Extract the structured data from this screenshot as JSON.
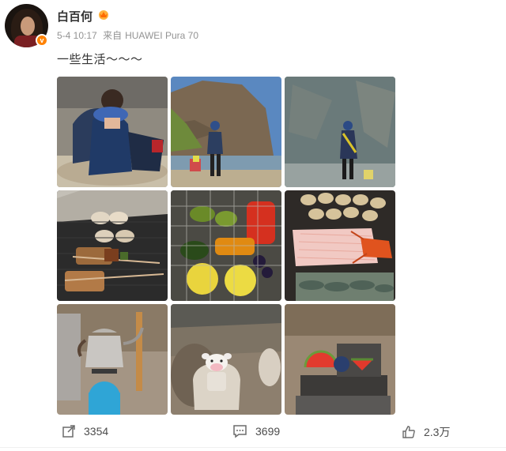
{
  "user": {
    "name": "白百何",
    "verified_badge": "v",
    "icons": {
      "avatar": "avatar",
      "verified": "verified-badge-icon",
      "member": "member-crown-icon"
    }
  },
  "meta": {
    "date": "5-4 10:17",
    "source_prefix": "来自",
    "device": "HUAWEI Pura 70"
  },
  "post": {
    "text": "一些生活～～～"
  },
  "photos": [
    {
      "name": "photo-1",
      "description": "child with cap crouching on rocky riverbank"
    },
    {
      "name": "photo-2",
      "description": "person walking by river under cliff"
    },
    {
      "name": "photo-3",
      "description": "person standing near cliff wall"
    },
    {
      "name": "photo-4",
      "description": "grilled skewers and oysters on grill"
    },
    {
      "name": "photo-5",
      "description": "vegetables and fruit in grill basket"
    },
    {
      "name": "photo-6",
      "description": "scallops, fish and lobster on ice"
    },
    {
      "name": "photo-7",
      "description": "kettle on camping stove"
    },
    {
      "name": "photo-8",
      "description": "small cow figure on rock"
    },
    {
      "name": "photo-9",
      "description": "watermelon slices on table"
    }
  ],
  "actions": {
    "share": {
      "count": "3354",
      "icon": "share-icon"
    },
    "comment": {
      "count": "3699",
      "icon": "comment-icon"
    },
    "like": {
      "count": "2.3万",
      "icon": "thumbs-up-icon"
    }
  },
  "colors": {
    "accent_orange": "#ff8200",
    "meta_gray": "#939393",
    "text": "#333333"
  }
}
